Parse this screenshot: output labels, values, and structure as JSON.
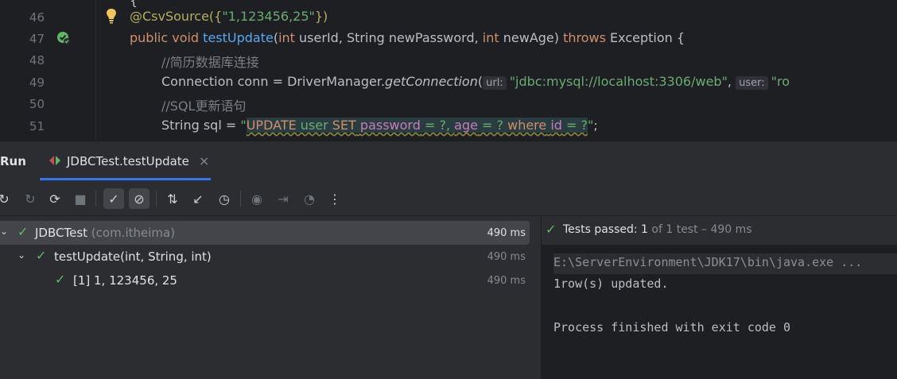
{
  "editor": {
    "lines": [
      {
        "num": "46",
        "icon": "lightbulb-icon"
      },
      {
        "num": "47",
        "icon": "run-test-passed-icon"
      },
      {
        "num": "48"
      },
      {
        "num": "49"
      },
      {
        "num": "50"
      },
      {
        "num": "51"
      }
    ],
    "code": {
      "l46_ann": "@CsvSource({",
      "l46_str": "\"1,123456,25\"",
      "l46_end": "})",
      "l47_kw1": "public void ",
      "l47_fn": "testUpdate",
      "l47_p1": "(",
      "l47_kw2": "int",
      "l47_p2": " userId, String newPassword, ",
      "l47_kw3": "int",
      "l47_p3": " newAge) ",
      "l47_kw4": "throws",
      "l47_p4": " Exception {",
      "l48_cm": "//简历数据库连接",
      "l49_a": "Connection conn = DriverManager.",
      "l49_fn": "getConnection",
      "l49_b": "(",
      "l49_hint1": "url:",
      "l49_str1": "\"jdbc:mysql://localhost:3306/web\"",
      "l49_c": ", ",
      "l49_hint2": "user:",
      "l49_str2": "\"ro",
      "l50_cm": "//SQL更新语句",
      "l51_a": "String sql = ",
      "l51_q1": "\"",
      "l51_k1": "UPDATE",
      "l51_s1": " user ",
      "l51_k2": "SET",
      "l51_s2": " ",
      "l51_id1": "password",
      "l51_s3": " = ?, ",
      "l51_id2": "age",
      "l51_s4": " = ? ",
      "l51_k3": "where",
      "l51_s5": " ",
      "l51_id3": "id",
      "l51_s6": " = ?",
      "l51_q2": "\"",
      "l51_end": ";"
    }
  },
  "run_panel": {
    "label": "Run",
    "tab": {
      "label": "JDBCTest.testUpdate",
      "close": "×"
    },
    "toolbar": [
      {
        "name": "rerun-icon",
        "glyph": "↻"
      },
      {
        "name": "rerun-failed-icon",
        "glyph": "↻"
      },
      {
        "name": "toggle-auto-test-icon",
        "glyph": "⟳"
      },
      {
        "name": "stop-icon",
        "glyph": "■"
      },
      {
        "name": "show-passed-icon",
        "glyph": "✓"
      },
      {
        "name": "show-ignored-icon",
        "glyph": "⊘"
      },
      {
        "name": "sort-icon",
        "glyph": "⇅"
      },
      {
        "name": "collapse-icon",
        "glyph": "↙"
      },
      {
        "name": "history-icon",
        "glyph": "◷"
      },
      {
        "name": "screenshot-icon",
        "glyph": "◉"
      },
      {
        "name": "import-icon",
        "glyph": "⇥"
      },
      {
        "name": "coverage-icon",
        "glyph": "◔"
      },
      {
        "name": "more-icon",
        "glyph": "⋮"
      }
    ],
    "tree": [
      {
        "name": "JDBCTest",
        "pkg": "(com.itheima)",
        "time": "490 ms"
      },
      {
        "name": "testUpdate(int, String, int)",
        "time": "490 ms"
      },
      {
        "name": "[1] 1, 123456, 25",
        "time": "490 ms"
      }
    ],
    "status": {
      "bold": "Tests passed: 1",
      "rest": " of 1 test – 490 ms"
    },
    "console": [
      "E:\\ServerEnvironment\\JDK17\\bin\\java.exe ...",
      "1row(s) updated.",
      "",
      "Process finished with exit code 0"
    ]
  },
  "colors": {
    "pass": "#5fb865",
    "accent": "#3574f0"
  }
}
